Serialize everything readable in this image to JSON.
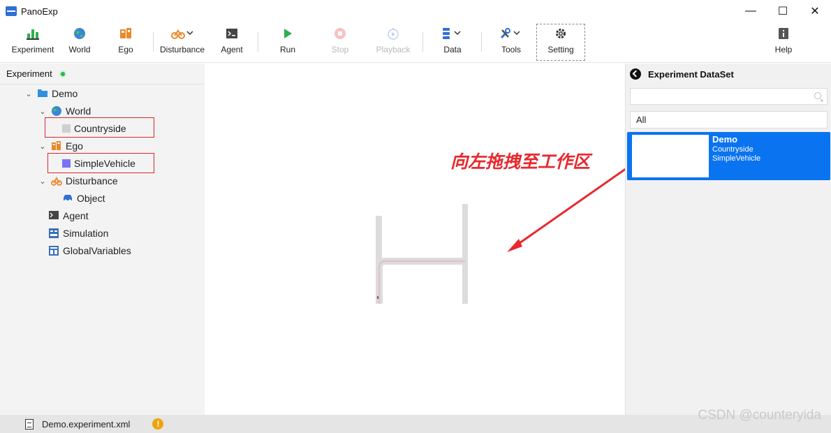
{
  "window": {
    "title": "PanoExp",
    "minimize": "—",
    "maximize": "☐",
    "close": "✕"
  },
  "toolbar": {
    "experiment": "Experiment",
    "world": "World",
    "ego": "Ego",
    "disturbance": "Disturbance",
    "agent": "Agent",
    "run": "Run",
    "stop": "Stop",
    "playback": "Playback",
    "data": "Data",
    "tools": "Tools",
    "setting": "Setting",
    "help": "Help"
  },
  "left_panel": {
    "title": "Experiment",
    "tree": {
      "demo": "Demo",
      "world": "World",
      "countryside": "Countryside",
      "ego": "Ego",
      "simple_vehicle": "SimpleVehicle",
      "disturbance": "Disturbance",
      "object": "Object",
      "agent": "Agent",
      "simulation": "Simulation",
      "global_variables": "GlobalVariables"
    }
  },
  "annotation": {
    "text": "向左拖拽至工作区"
  },
  "right_panel": {
    "title": "Experiment DataSet",
    "search_placeholder": "",
    "filter_value": "All",
    "card": {
      "title": "Demo",
      "world": "Countryside",
      "vehicle": "SimpleVehicle"
    }
  },
  "statusbar": {
    "file": "Demo.experiment.xml"
  },
  "watermark": "CSDN @counteryida",
  "colors": {
    "accent": "#0a74f0",
    "highlight_box": "#d9262c",
    "annotation": "#e8282e",
    "status_ok": "#2db34a",
    "warning": "#f0a20a"
  },
  "icons": {
    "experiment": "bar-chart-icon",
    "world": "globe-icon",
    "ego": "vehicle-icon",
    "disturbance": "disturbance-icon",
    "agent": "terminal-icon",
    "run": "play-icon",
    "stop": "stop-icon",
    "playback": "playback-icon",
    "data": "database-icon",
    "tools": "tools-icon",
    "setting": "gear-icon",
    "help": "help-icon"
  }
}
